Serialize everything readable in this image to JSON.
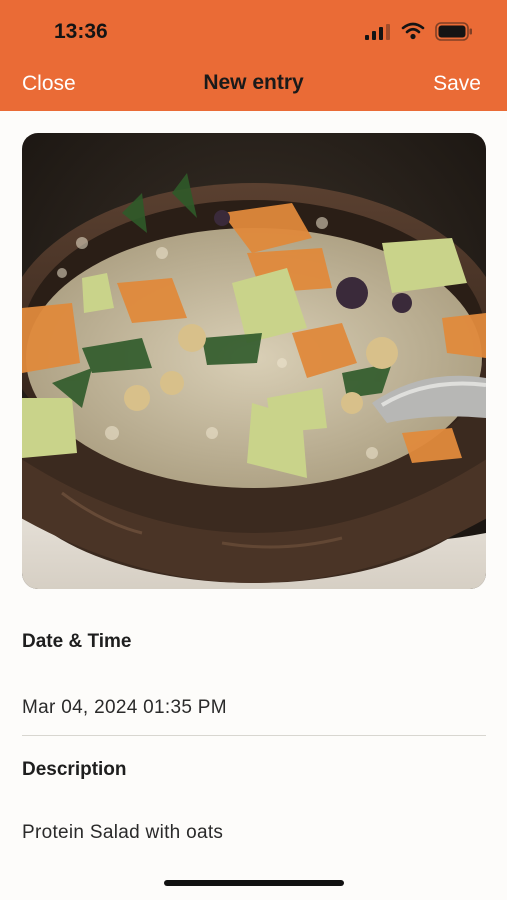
{
  "status_bar": {
    "time": "13:36"
  },
  "nav": {
    "close_label": "Close",
    "title": "New entry",
    "save_label": "Save"
  },
  "photo": {
    "subject": "food-photo"
  },
  "date_time": {
    "label": "Date & Time",
    "value": "Mar 04, 2024 01:35 PM"
  },
  "description": {
    "label": "Description",
    "value": "Protein Salad with oats"
  },
  "colors": {
    "header": "#ea6b36",
    "background": "#fdfcfa",
    "text": "#1c1c1c"
  }
}
